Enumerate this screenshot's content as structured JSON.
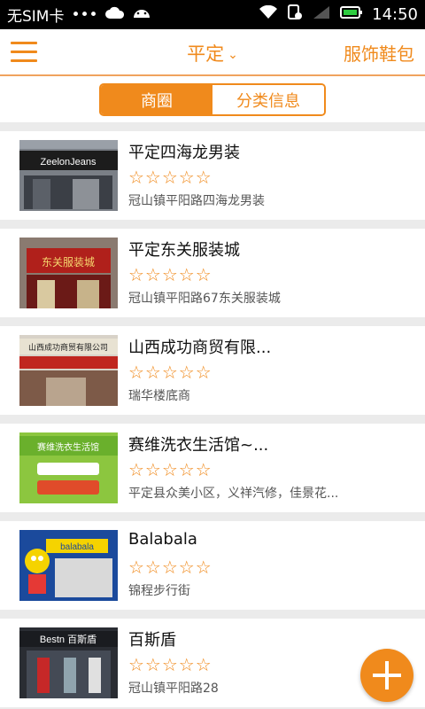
{
  "status_bar": {
    "carrier": "无SIM卡",
    "dots": "•••",
    "time": "14:50",
    "icons": [
      "cloud-icon",
      "android-icon",
      "wifi-icon",
      "sim-blocked-icon",
      "signal-icon",
      "battery-icon"
    ]
  },
  "header": {
    "city": "平定",
    "category": "服饰鞋包"
  },
  "tabs": [
    {
      "label": "商圈",
      "active": true
    },
    {
      "label": "分类信息",
      "active": false
    }
  ],
  "stores": [
    {
      "name": "平定四海龙男装",
      "address": "冠山镇平阳路四海龙男装",
      "thumb_text": "ZeelonJeans"
    },
    {
      "name": "平定东关服装城",
      "address": "冠山镇平阳路67东关服装城",
      "thumb_text": "东关服装城"
    },
    {
      "name": "山西成功商贸有限...",
      "address": "瑞华楼底商",
      "thumb_text": "山西成功商贸有限公司"
    },
    {
      "name": "赛维洗衣生活馆~...",
      "address": "平定县众美小区，义祥汽修，佳景花...",
      "thumb_text": "赛维洗衣生活馆"
    },
    {
      "name": "Balabala",
      "address": "锦程步行街",
      "thumb_text": "balabala"
    },
    {
      "name": "百斯盾",
      "address": "冠山镇平阳路28",
      "thumb_text": "Bestn 百斯盾"
    }
  ],
  "stars": "☆☆☆☆☆",
  "colors": {
    "accent": "#f08a1c"
  }
}
